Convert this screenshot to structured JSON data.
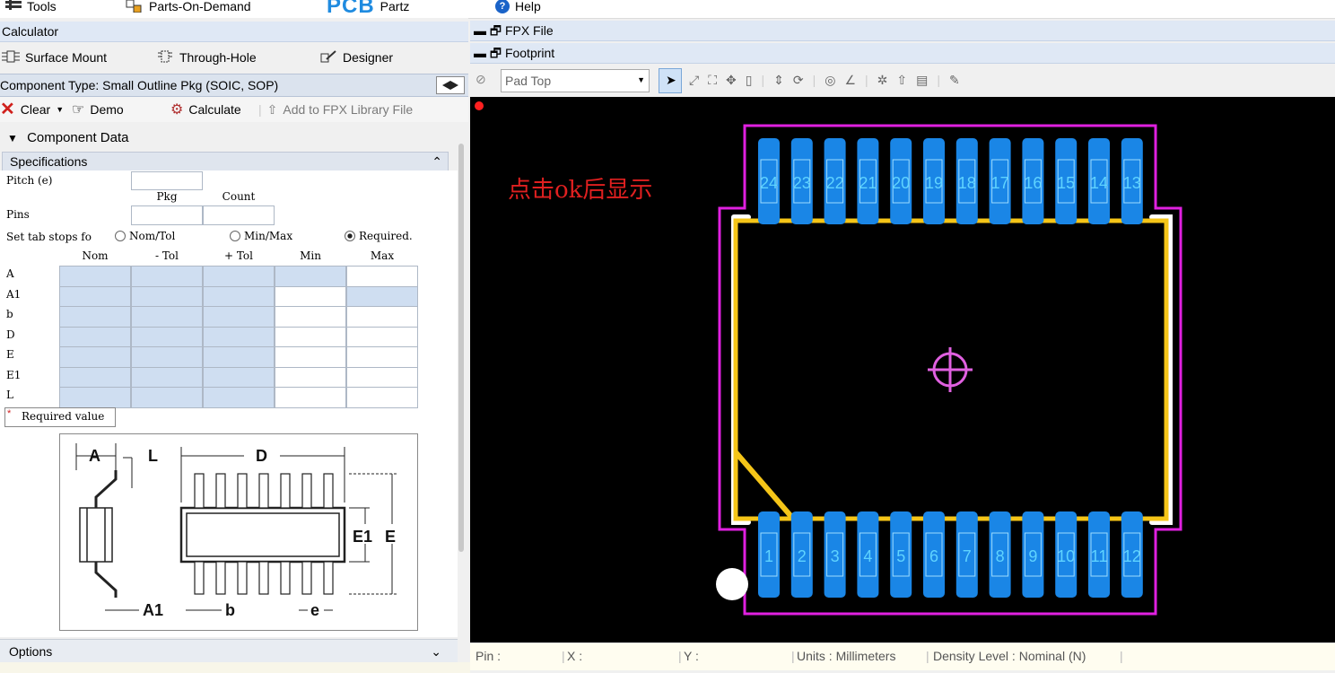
{
  "menu": {
    "tools": "Tools",
    "parts_on_demand": "Parts-On-Demand",
    "logo": "PCB",
    "partz": "Partz",
    "help": "Help"
  },
  "calculator": {
    "title": "Calculator",
    "tabs": [
      "Surface Mount",
      "Through-Hole",
      "Designer"
    ]
  },
  "component_type": "Component Type: Small Outline Pkg (SOIC, SOP)",
  "toolbar": {
    "clear": "Clear",
    "demo": "Demo",
    "calculate": "Calculate",
    "add_fpx": "Add to FPX Library File"
  },
  "component_data": "Component Data",
  "specifications": {
    "title": "Specifications",
    "pitch": "Pitch (e)",
    "pkg": "Pkg",
    "count": "Count",
    "pins": "Pins",
    "tab_stops": "Set tab stops fo",
    "radio_nomtol": "Nom/Tol",
    "radio_minmax": "Min/Max",
    "radio_required": "Required.",
    "columns": [
      "Nom",
      "- Tol",
      "+ Tol",
      "Min",
      "Max"
    ],
    "rows": [
      "A",
      "A1",
      "b",
      "D",
      "E",
      "E1",
      "L"
    ],
    "required_note": "Required value"
  },
  "diagram": {
    "A": "A",
    "L": "L",
    "D": "D",
    "E1": "E1",
    "E": "E",
    "A1": "A1",
    "b": "b",
    "e": "e"
  },
  "options": "Options",
  "right": {
    "fpx_file": "FPX File",
    "footprint": "Footprint",
    "layer": "Pad Top",
    "annotation": "点击ok后显示",
    "top_pins": [
      "24",
      "23",
      "22",
      "21",
      "20",
      "19",
      "18",
      "17",
      "16",
      "15",
      "14",
      "13"
    ],
    "bottom_pins": [
      "1",
      "2",
      "3",
      "4",
      "5",
      "6",
      "7",
      "8",
      "9",
      "10",
      "11",
      "12"
    ]
  },
  "status": {
    "pin": "Pin :",
    "x": "X :",
    "y": "Y :",
    "units": "Units :  Millimeters",
    "density": "Density Level :  Nominal (N)"
  },
  "colors": {
    "pad": "#1a86e6",
    "silk_yellow": "#f5c518",
    "courtyard": "#e020e0",
    "annotation": "#e02020"
  }
}
